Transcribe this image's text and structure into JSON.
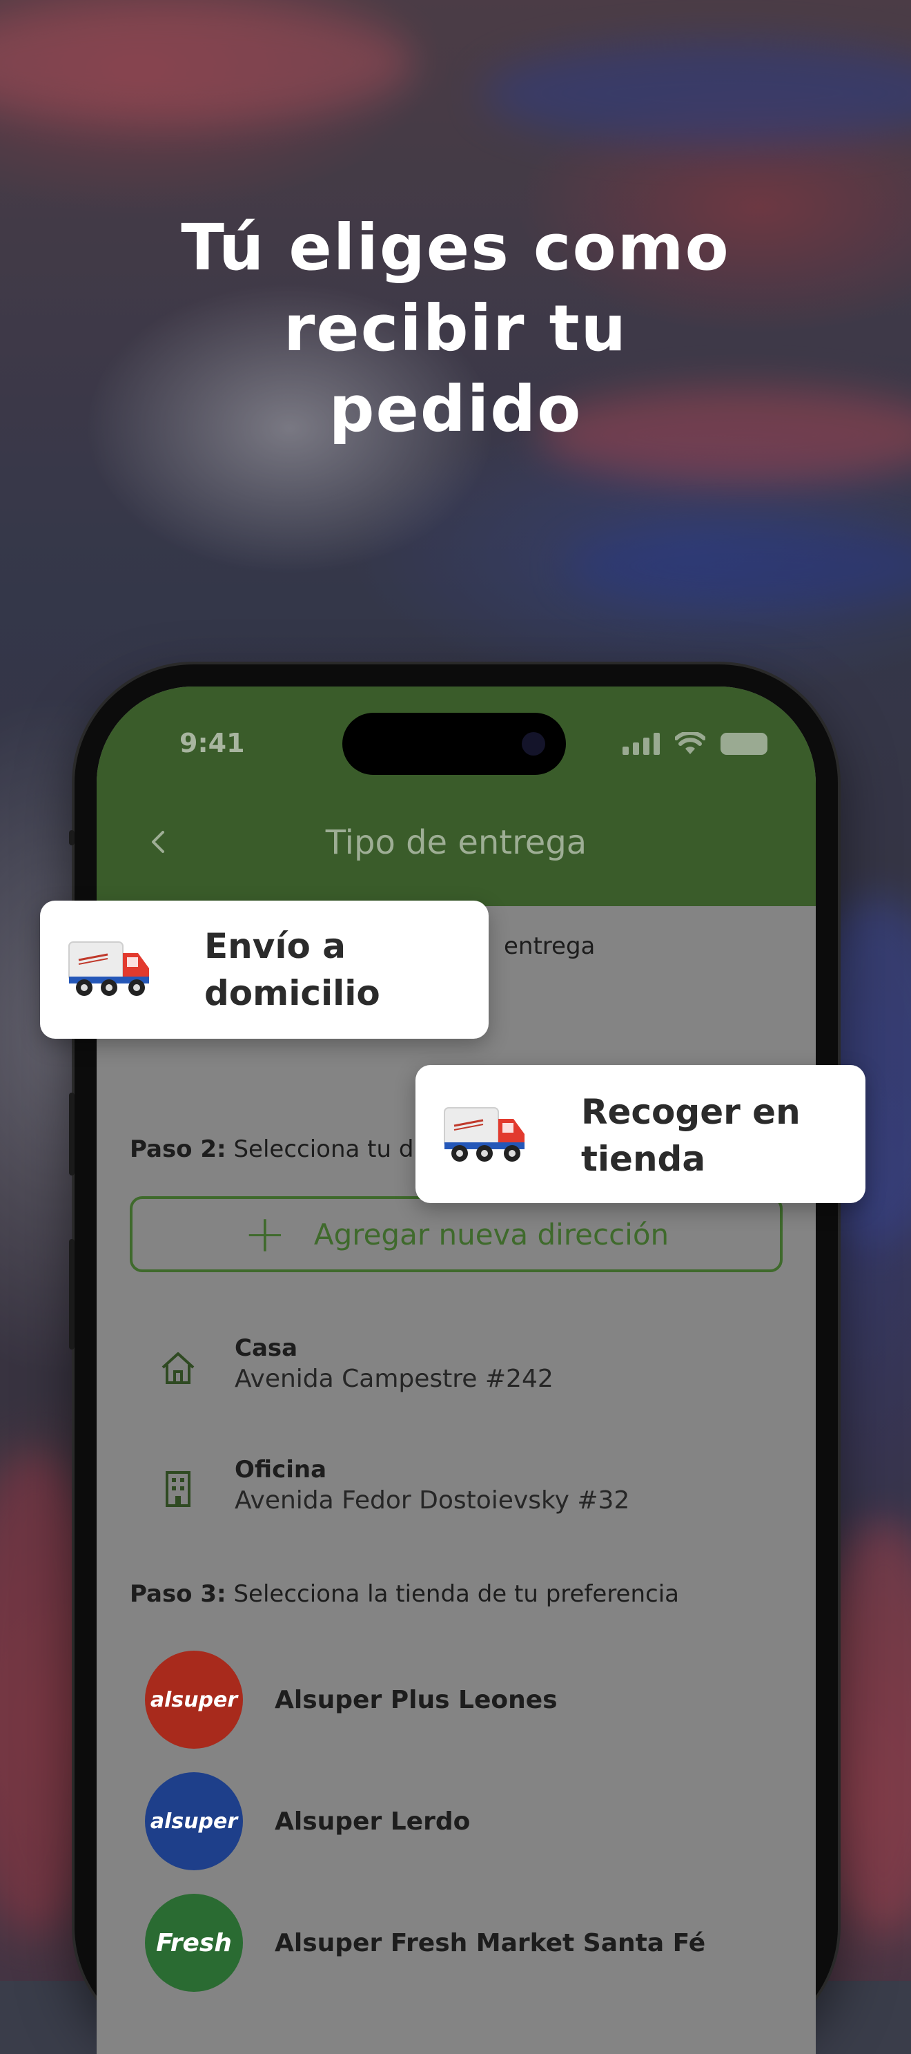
{
  "headline": {
    "line1": "Tú eliges como",
    "line2": "recibir tu",
    "line3": "pedido"
  },
  "status_bar": {
    "time": "9:41",
    "icons": [
      "signal-icon",
      "wifi-icon",
      "battery-icon"
    ]
  },
  "app_bar": {
    "back_icon": "chevron-left-icon",
    "title": "Tipo de entrega"
  },
  "step1": {
    "hidden_text": "entrega"
  },
  "step2": {
    "label": "Paso 2:",
    "text": "Selecciona tu dire"
  },
  "add_address": {
    "icon": "plus-icon",
    "label": "Agregar nueva dirección"
  },
  "addresses": [
    {
      "icon": "home-icon",
      "name": "Casa",
      "line": "Avenida Campestre #242"
    },
    {
      "icon": "building-icon",
      "name": "Oficina",
      "line": "Avenida Fedor Dostoievsky #32"
    }
  ],
  "step3": {
    "label": "Paso 3:",
    "text": "Selecciona la tienda de tu preferencia"
  },
  "stores": [
    {
      "logo_text": "alsuper",
      "logo_color": "#a82a1c",
      "name": "Alsuper Plus Leones"
    },
    {
      "logo_text": "alsuper",
      "logo_color": "#1e3f8a",
      "name": "Alsuper Lerdo"
    },
    {
      "logo_text": "Fresh",
      "logo_color": "#2a6b32",
      "name": "Alsuper Fresh Market Santa Fé"
    }
  ],
  "cards": {
    "home_delivery": {
      "icon": "delivery-truck-icon",
      "line1": "Envío a",
      "line2": "domicilio"
    },
    "store_pickup": {
      "icon": "delivery-truck-icon",
      "line1": "Recoger en",
      "line2": "tienda"
    }
  },
  "colors": {
    "brand_green": "#3a5c2a",
    "accent_green": "#3f6a2c",
    "truck_red": "#e23a2e",
    "truck_blue": "#2457b8"
  }
}
